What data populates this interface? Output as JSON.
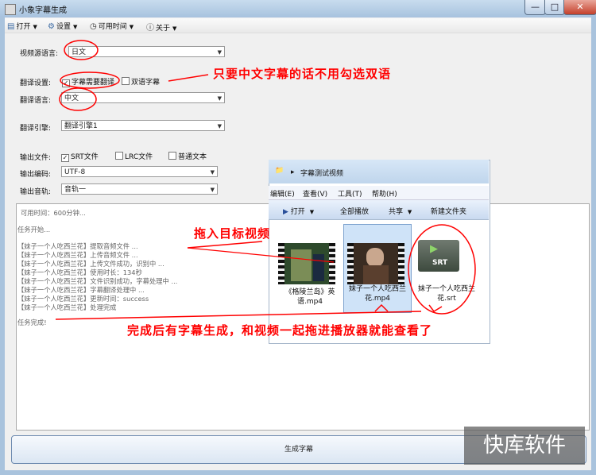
{
  "window": {
    "title": "小象字幕生成",
    "min": "—",
    "max": "□",
    "close": "✕"
  },
  "menu": [
    {
      "label": "打开",
      "icon": "open-icon"
    },
    {
      "label": "设置",
      "icon": "gear-icon"
    },
    {
      "label": "可用时间",
      "icon": "clock-icon"
    },
    {
      "label": "关于",
      "icon": "info-icon"
    }
  ],
  "form": {
    "source_lang_label": "视频源语言:",
    "source_lang_value": "日文",
    "translate_settings_label": "翻译设置:",
    "need_translate_label": "字幕需要翻译",
    "need_translate_checked": true,
    "bilingual_label": "双语字幕",
    "bilingual_checked": false,
    "translate_lang_label": "翻译语言:",
    "translate_lang_value": "中文",
    "engine_label": "翻译引擎:",
    "engine_value": "翻译引擎1",
    "output_file_label": "输出文件:",
    "srt_label": "SRT文件",
    "srt_checked": true,
    "lrc_label": "LRC文件",
    "lrc_checked": false,
    "txt_label": "普通文本",
    "txt_checked": false,
    "encoding_label": "输出编码:",
    "encoding_value": "UTF-8",
    "audio_track_label": "输出音轨:",
    "audio_track_value": "音轨一"
  },
  "log": {
    "available_time": "可用时间：600分钟...",
    "lines": [
      "任务开始...",
      "",
      "【妹子一个人吃西兰花】提取音频文件 ...",
      "【妹子一个人吃西兰花】上传音频文件 ...",
      "【妹子一个人吃西兰花】上传文件成功，识别中 ...",
      "【妹子一个人吃西兰花】使用时长：134秒",
      "【妹子一个人吃西兰花】文件识别成功，字幕处理中 ...",
      "【妹子一个人吃西兰花】字幕翻译处理中 ...",
      "【妹子一个人吃西兰花】更新时间：success",
      "【妹子一个人吃西兰花】处理完成",
      "",
      "任务完成!"
    ]
  },
  "generate_button": "生成字幕",
  "explorer": {
    "path": "字幕测试视频",
    "menu": [
      "编辑(E)",
      "查看(V)",
      "工具(T)",
      "帮助(H)"
    ],
    "toolbar": [
      "打开",
      "全部播放",
      "共享",
      "新建文件夹"
    ],
    "files": [
      {
        "name": "《格陵兰岛》英语.mp4",
        "type": "video"
      },
      {
        "name": "妹子一个人吃西兰花.mp4",
        "type": "video"
      },
      {
        "name": "妹子一个人吃西兰花.srt",
        "type": "srt",
        "badge": "SRT"
      }
    ]
  },
  "annotations": {
    "bilingual_note": "只要中文字幕的话不用勾选双语",
    "drag_note": "拖入目标视频",
    "done_note": "完成后有字幕生成，和视频一起拖进播放器就能查看了"
  },
  "watermark": "快库软件",
  "colors": {
    "annotation": "#ff0000",
    "title_bar": "#a7c2de"
  }
}
